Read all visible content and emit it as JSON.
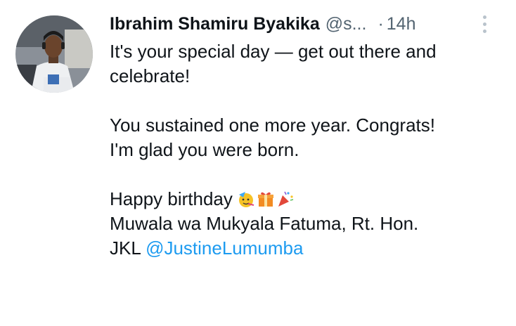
{
  "tweet": {
    "author": {
      "name": "Ibrahim Shamiru Byakika",
      "handle": "@s...",
      "time": "14h",
      "time_separator": "·"
    },
    "lines": [
      "It's your special day — get out there and",
      "celebrate!",
      "You sustained one more year. Congrats!",
      "I'm glad you were born.",
      "Happy birthday",
      "Muwala wa Mukyala Fatuma, Rt. Hon.",
      "JKL",
      "@JustineLumumba"
    ],
    "emojis": [
      "partying-face-icon",
      "gift-icon",
      "party-popper-icon"
    ],
    "colors": {
      "text": "#0f1419",
      "secondary": "#536471",
      "link": "#1d9bf0"
    }
  }
}
